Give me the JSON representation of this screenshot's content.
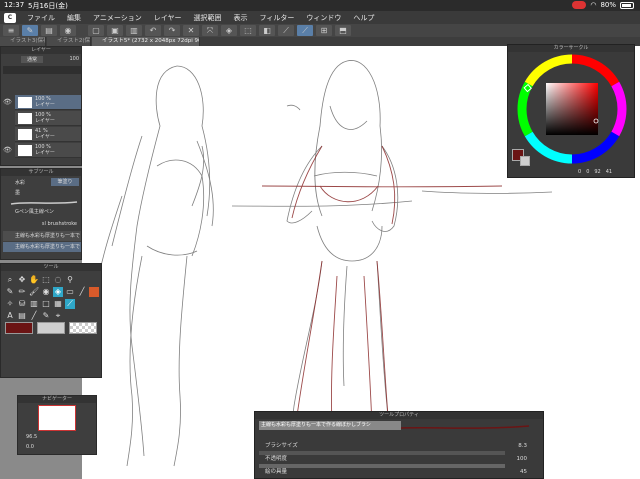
{
  "status": {
    "time": "12:37",
    "date": "5月16日(金)",
    "battery": "80%"
  },
  "menu": {
    "items": [
      "ファイル",
      "編集",
      "アニメーション",
      "レイヤー",
      "選択範囲",
      "表示",
      "フィルター",
      "ウィンドウ",
      "ヘルプ"
    ]
  },
  "tabs": [
    {
      "label": "イラスト3(保存)"
    },
    {
      "label": "イラスト2(保存)"
    },
    {
      "label": "イラスト5* (2732 x 2048px 72dpi 96.5%)"
    }
  ],
  "layers": {
    "title": "レイヤー",
    "blend": "通常",
    "opacity_top": "100",
    "rows": [
      {
        "opacity": "100 %",
        "name": "レイヤー"
      },
      {
        "opacity": "100 %",
        "name": "レイヤー"
      },
      {
        "opacity": "41 %",
        "name": "レイヤー"
      },
      {
        "opacity": "100 %",
        "name": "レイヤー"
      }
    ]
  },
  "subtool": {
    "title": "サブツール",
    "tab": "筆塗り",
    "groups": [
      "水彩",
      "墨"
    ],
    "brushes": [
      "Gペン風主線ペン",
      "sl brushstroke",
      "主線も水彩も厚塗りも一本で",
      "主線も水彩も厚塗りも一本で"
    ]
  },
  "tools": {
    "title": "ツール"
  },
  "navigator": {
    "title": "ナビゲーター",
    "zoom": "96.5",
    "angle": "0.0"
  },
  "color": {
    "title": "カラーサークル",
    "values": [
      "0",
      "0",
      "92",
      "41"
    ],
    "main_color": "#6b1414",
    "sub_color": "#cfcfcf"
  },
  "toolprop": {
    "title": "ツールプロパティ",
    "brush_name": "主線も水彩も厚塗りも一本で作る線ぼかしブラシ",
    "brush_size_label": "ブラシサイズ",
    "brush_size_value": "8.3",
    "opacity_label": "不透明度",
    "opacity_value": "100",
    "ink_label": "絵の具量",
    "ink_value": "45"
  }
}
